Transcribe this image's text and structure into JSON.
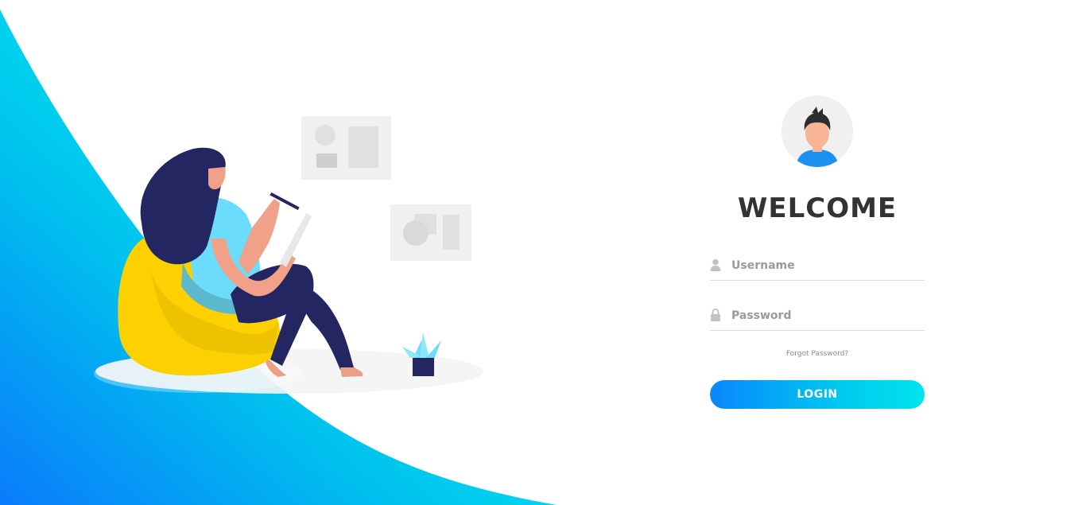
{
  "login": {
    "title": "WELCOME",
    "username_placeholder": "Username",
    "password_placeholder": "Password",
    "forgot_password": "Forgot Password?",
    "login_button": "LOGIN"
  },
  "icons": {
    "avatar": "user-avatar-icon",
    "username": "user-icon",
    "password": "lock-icon",
    "illustration": "woman-reading-on-beanbag-illustration",
    "plant": "potted-plant-icon"
  },
  "colors": {
    "gradient_start": "#0a87fb",
    "gradient_end": "#00e4ee",
    "title": "#333333",
    "accent_yellow": "#fcd001",
    "navy": "#232661"
  }
}
